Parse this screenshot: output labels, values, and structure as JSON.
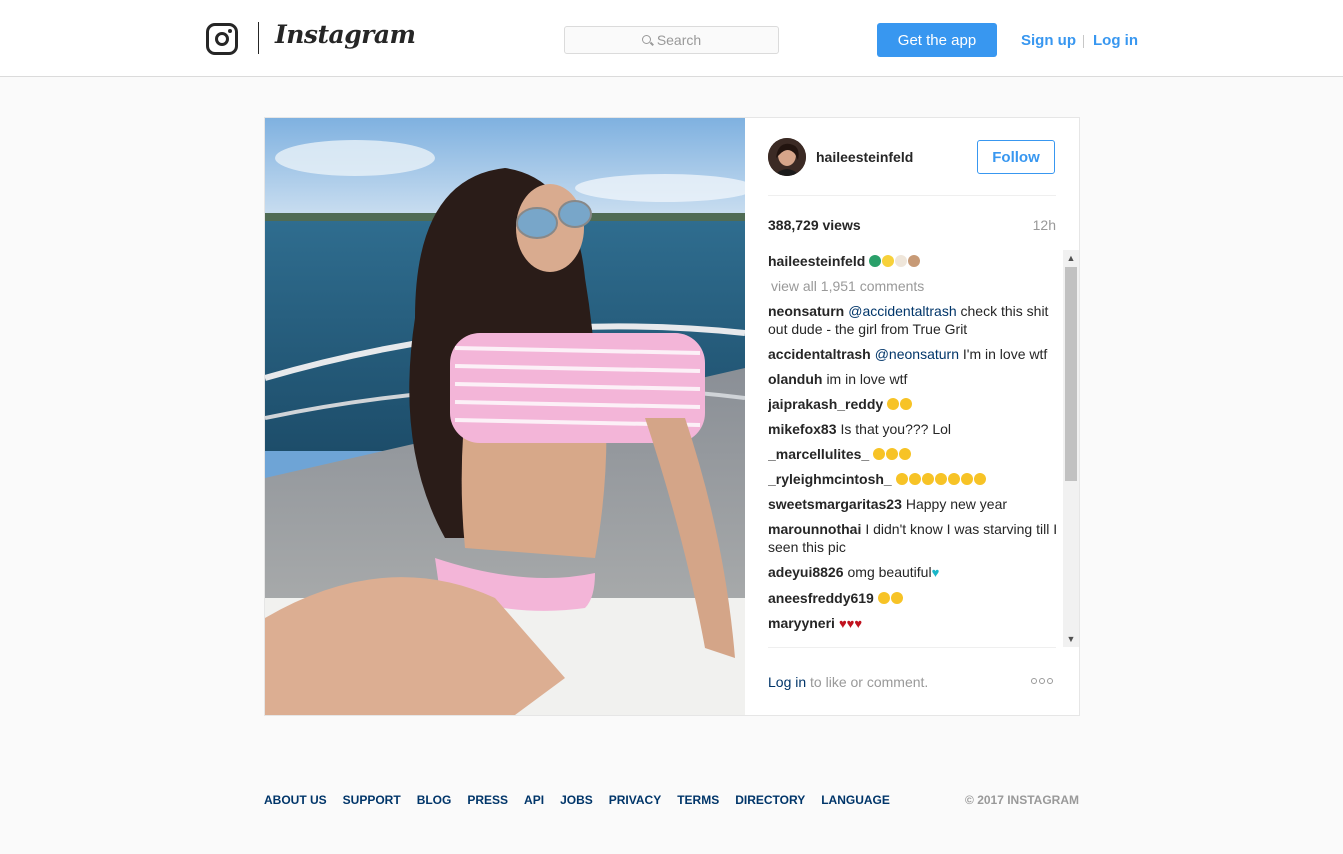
{
  "header": {
    "wordmark": "Instagram",
    "search_placeholder": "Search",
    "get_app_label": "Get the app",
    "signup_label": "Sign up",
    "login_label": "Log in"
  },
  "post": {
    "username": "haileesteinfeld",
    "follow_label": "Follow",
    "views": "388,729 views",
    "age": "12h",
    "caption_user": "haileesteinfeld",
    "view_all": "view all 1,951 comments",
    "comments": [
      {
        "user": "neonsaturn",
        "mention": "@accidentaltrash",
        "text": "check this shit out dude - the girl from True Grit"
      },
      {
        "user": "accidentaltrash",
        "mention": "@neonsaturn",
        "text": "I'm in love wtf"
      },
      {
        "user": "olanduh",
        "text": "im in love wtf"
      },
      {
        "user": "jaiprakash_reddy",
        "text": ""
      },
      {
        "user": "mikefox83",
        "text": "Is that you??? Lol"
      },
      {
        "user": "_marcellulites_",
        "text": ""
      },
      {
        "user": "_ryleighmcintosh_",
        "text": ""
      },
      {
        "user": "sweetsmargaritas23",
        "text": "Happy new year"
      },
      {
        "user": "marounnothai",
        "text": "I didn't know I was starving till I seen this pic"
      },
      {
        "user": "adeyui8826",
        "text": "omg beautiful"
      },
      {
        "user": "aneesfreddy619",
        "text": ""
      },
      {
        "user": "maryyneri",
        "text": ""
      }
    ],
    "login_prompt_link": "Log in",
    "login_prompt_text": "to like or comment."
  },
  "footer": {
    "links": [
      "ABOUT US",
      "SUPPORT",
      "BLOG",
      "PRESS",
      "API",
      "JOBS",
      "PRIVACY",
      "TERMS",
      "DIRECTORY",
      "LANGUAGE"
    ],
    "copyright": "© 2017 INSTAGRAM"
  },
  "icons": [
    "instagram-logo-icon",
    "search-icon",
    "more-options-icon",
    "scroll-up-icon",
    "scroll-down-icon"
  ],
  "colors": {
    "accent": "#3897f0",
    "link_dark": "#003569",
    "muted": "#999999",
    "border": "#dbdbdb"
  }
}
